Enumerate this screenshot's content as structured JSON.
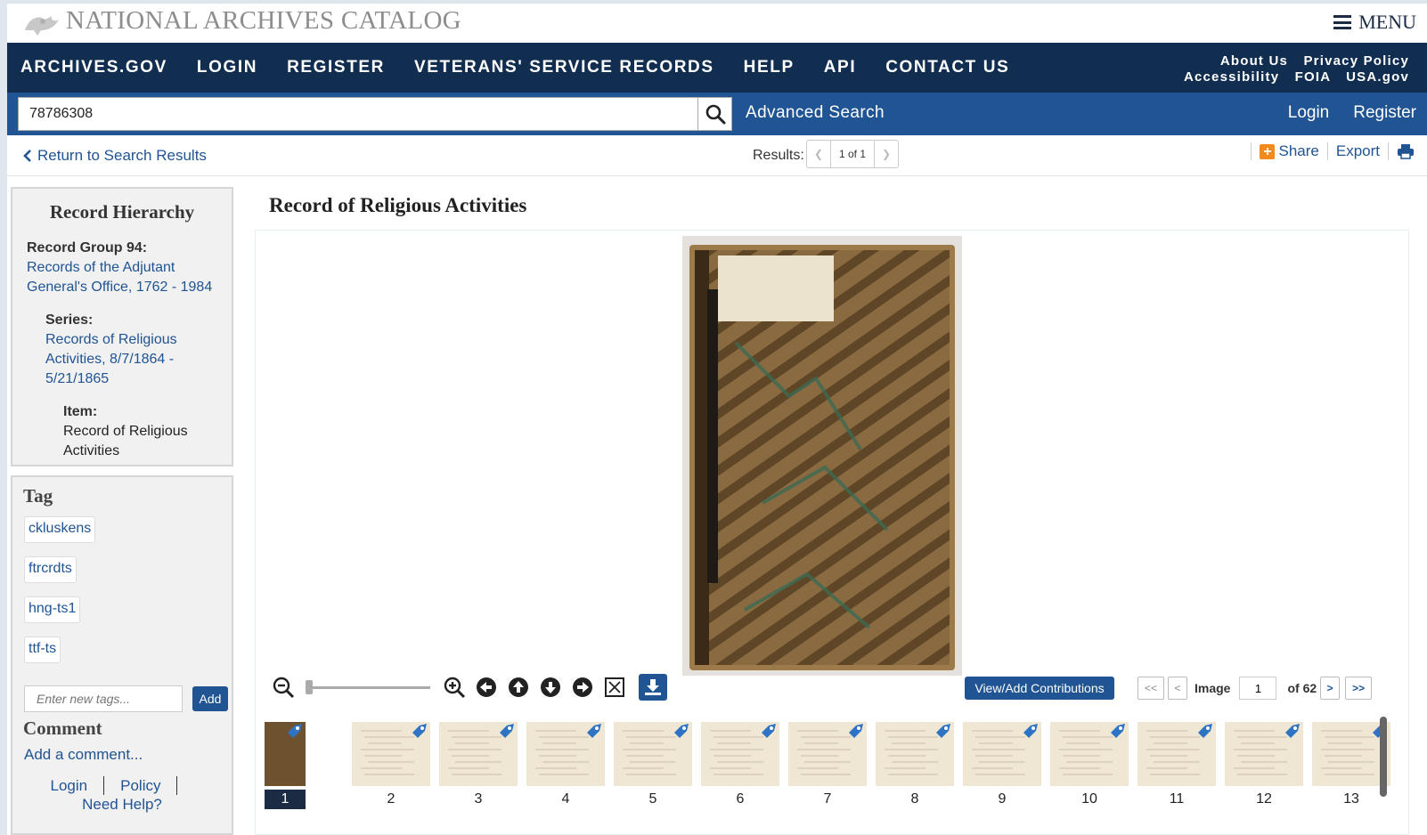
{
  "header": {
    "site_title": "NATIONAL ARCHIVES CATALOG",
    "menu_label": "MENU"
  },
  "nav": {
    "links": [
      "ARCHIVES.GOV",
      "LOGIN",
      "REGISTER",
      "VETERANS' SERVICE RECORDS",
      "HELP",
      "API",
      "CONTACT US"
    ],
    "utility_row1": [
      "About Us",
      "Privacy Policy"
    ],
    "utility_row2": [
      "Accessibility",
      "FOIA",
      "USA.gov"
    ]
  },
  "search": {
    "value": "78786308",
    "advanced_label": "Advanced Search",
    "login_label": "Login",
    "register_label": "Register"
  },
  "results": {
    "return_label": "Return to Search Results",
    "results_label": "Results:",
    "position": "1 of 1",
    "share_label": "Share",
    "export_label": "Export"
  },
  "hierarchy": {
    "title": "Record Hierarchy",
    "record_group_label": "Record Group 94:",
    "record_group_link": "Records of the Adjutant General's Office, 1762 - 1984",
    "series_label": "Series:",
    "series_link": "Records of Religious Activities, 8/7/1864 - 5/21/1865",
    "item_label": "Item:",
    "item_text": "Record of Religious Activities"
  },
  "tags": {
    "title": "Tag",
    "items": [
      "ckluskens",
      "ftrcrdts",
      "hng-ts1",
      "ttf-ts"
    ],
    "input_placeholder": "Enter new tags...",
    "add_label": "Add"
  },
  "comment": {
    "title": "Comment",
    "add_label": "Add a comment...",
    "login_label": "Login",
    "policy_label": "Policy",
    "help_label": "Need Help?"
  },
  "record": {
    "title": "Record of Religious Activities"
  },
  "viewer": {
    "contributions_label": "View/Add Contributions",
    "first_label": "<<",
    "prev_label": "<",
    "image_label": "Image",
    "current_image": "1",
    "of_label": "of 62",
    "next_label": ">",
    "last_label": ">>",
    "zoom_level": 0.0
  },
  "thumbnails": {
    "numbers": [
      "1",
      "2",
      "3",
      "4",
      "5",
      "6",
      "7",
      "8",
      "9",
      "10",
      "11",
      "12",
      "13"
    ],
    "active": "1"
  },
  "colors": {
    "nav_bg": "#112e51",
    "search_bg": "#205493",
    "link": "#205493",
    "share_accent": "#f38b1c"
  }
}
